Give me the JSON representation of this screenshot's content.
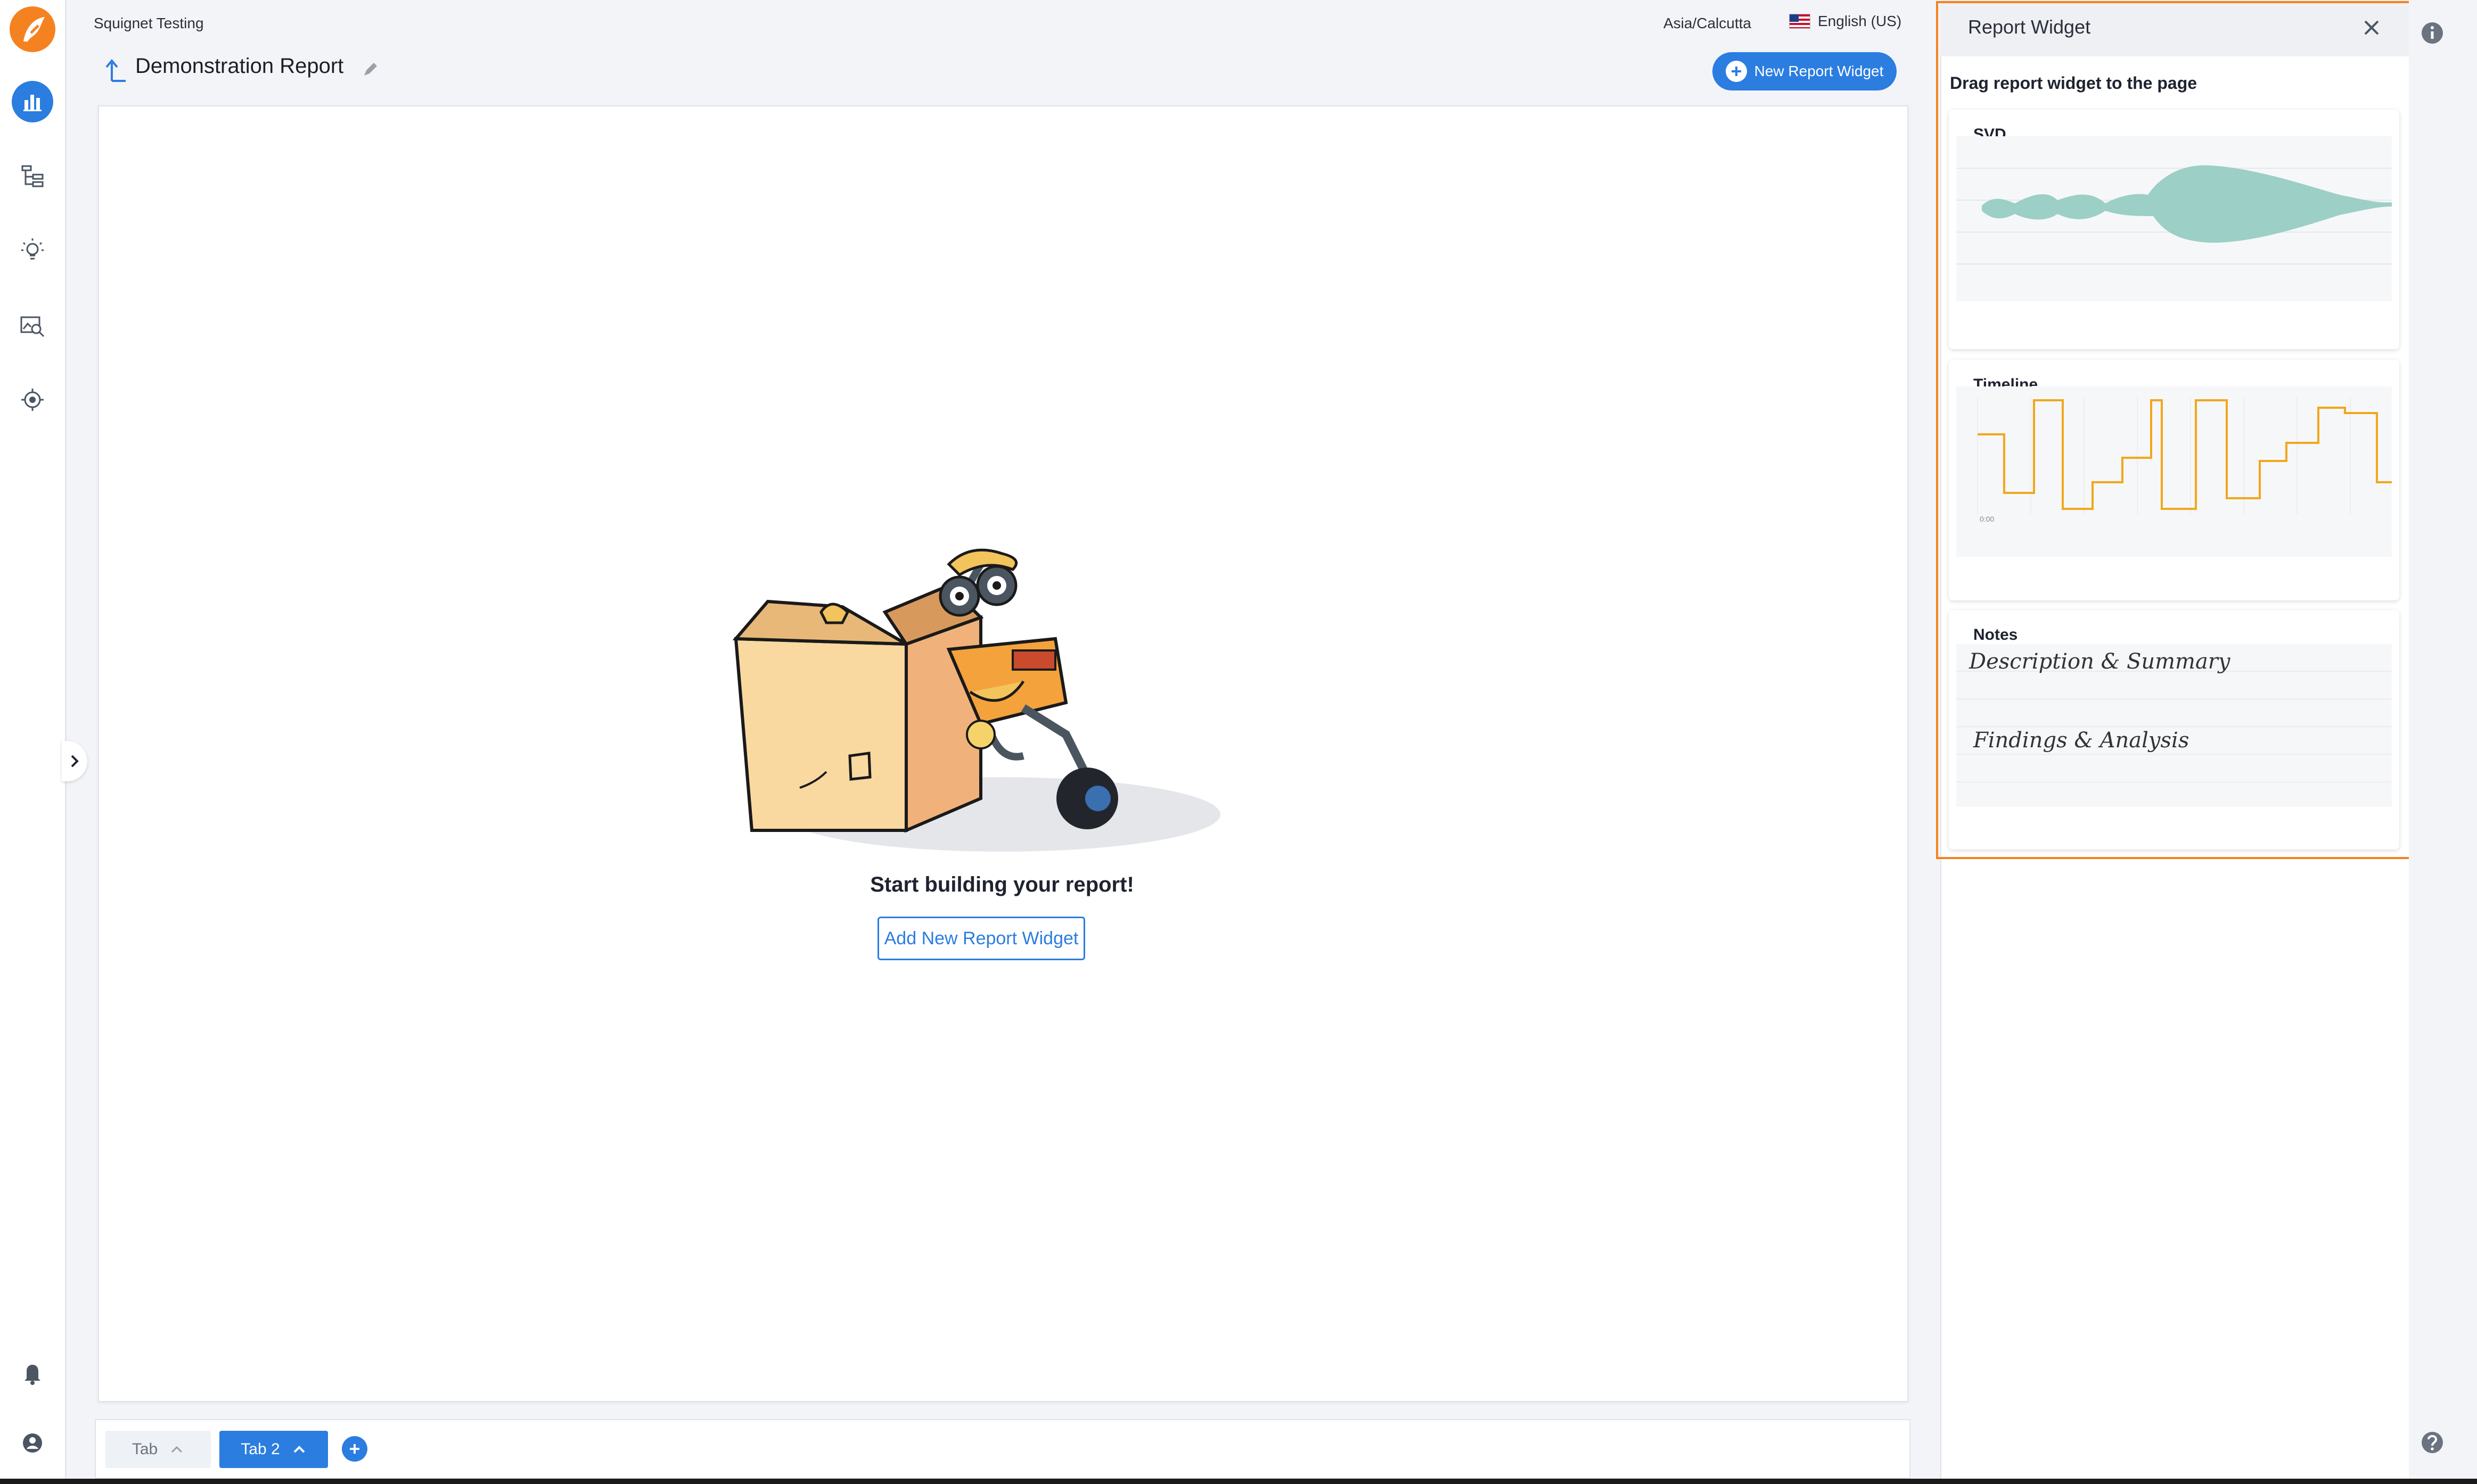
{
  "header": {
    "org_name": "Squignet Testing",
    "timezone": "Asia/Calcutta",
    "language": "English (US)",
    "report_title": "Demonstration Report",
    "new_widget_label": "New Report Widget"
  },
  "sidebar": {
    "items": [
      {
        "icon": "bar-chart-icon",
        "active": true
      },
      {
        "icon": "hierarchy-icon",
        "active": false
      },
      {
        "icon": "lightbulb-icon",
        "active": false
      },
      {
        "icon": "image-search-icon",
        "active": false
      },
      {
        "icon": "target-icon",
        "active": false
      }
    ],
    "bottom": [
      {
        "icon": "bell-icon"
      },
      {
        "icon": "account-icon"
      }
    ]
  },
  "canvas": {
    "empty_title": "Start building your report!",
    "add_button_label": "Add New Report Widget"
  },
  "tabs": [
    {
      "label": "Tab",
      "active": false
    },
    {
      "label": "Tab 2",
      "active": true
    }
  ],
  "widget_panel": {
    "title": "Report Widget",
    "subtitle": "Drag report widget to the page",
    "widgets": [
      {
        "label": "SVD"
      },
      {
        "label": "Timeline"
      },
      {
        "label": "Notes",
        "preview_lines": [
          "Description & Summary",
          "Findings & Analysis"
        ]
      }
    ]
  },
  "colors": {
    "accent": "#2b7de0",
    "highlight": "#f58220",
    "svd_fill": "#9ccfc6",
    "timeline_line": "#f0a81c"
  }
}
